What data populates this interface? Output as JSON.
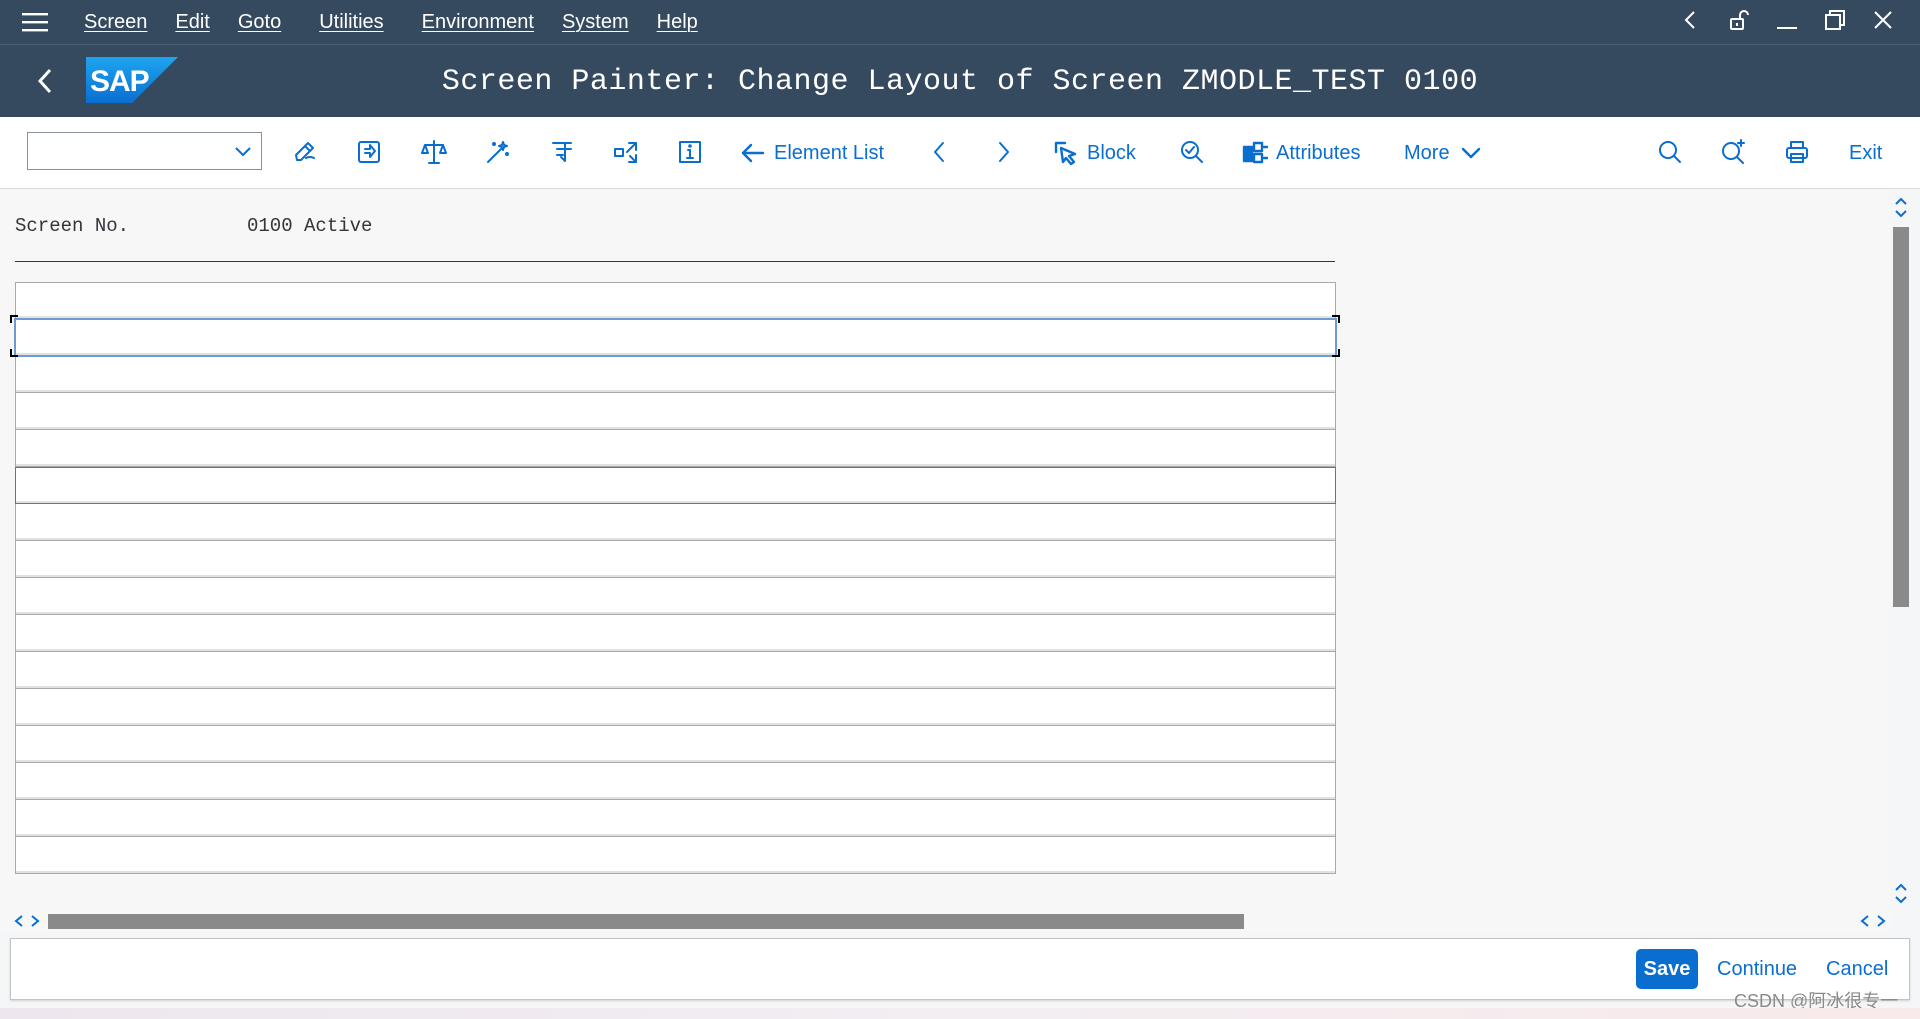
{
  "menubar": {
    "items": [
      "Screen",
      "Edit",
      "Goto",
      "Utilities",
      "Environment",
      "System",
      "Help"
    ]
  },
  "titlebar": {
    "logo_text": "SAP",
    "title": "Screen Painter: Change Layout of Screen ZMODLE_TEST 0100"
  },
  "toolbar": {
    "command_value": "",
    "element_list_label": "Element List",
    "block_label": "Block",
    "attributes_label": "Attributes",
    "more_label": "More",
    "exit_label": "Exit"
  },
  "content": {
    "screen_no_label": "Screen No.",
    "screen_no_value": "0100 Active"
  },
  "footer": {
    "save_label": "Save",
    "continue_label": "Continue",
    "cancel_label": "Cancel"
  },
  "watermark": "CSDN @阿冰很专一",
  "colors": {
    "shell_bg": "#354a5f",
    "accent": "#0a6ed1",
    "content_bg": "#f7f7f7"
  }
}
